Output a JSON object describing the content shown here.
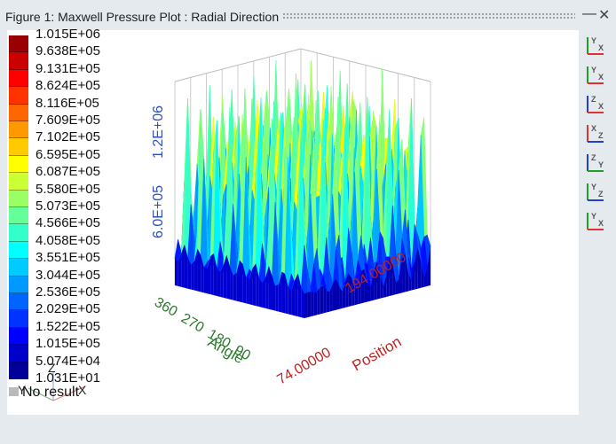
{
  "window": {
    "title": "Figure 1: Maxwell Pressure Plot : Radial Direction",
    "minimize": "—",
    "close": "✕"
  },
  "legend": {
    "labels": [
      "1.015E+06",
      "9.638E+05",
      "9.131E+05",
      "8.624E+05",
      "8.116E+05",
      "7.609E+05",
      "7.102E+05",
      "6.595E+05",
      "6.087E+05",
      "5.580E+05",
      "5.073E+05",
      "4.566E+05",
      "4.058E+05",
      "3.551E+05",
      "3.044E+05",
      "2.536E+05",
      "2.029E+05",
      "1.522E+05",
      "1.015E+05",
      "5.074E+04",
      "1.031E+01"
    ],
    "no_result": "No result"
  },
  "axes": {
    "z_ticks": [
      "1.2E+06",
      "6.0E+05"
    ],
    "angle_ticks": [
      "360",
      "270",
      "180",
      "90"
    ],
    "angle_label": "Angle",
    "position_ticks": [
      "194.00000",
      "74.00000"
    ],
    "position_label": "Position",
    "triad": {
      "x": "X",
      "y": "Y",
      "z": "Z"
    },
    "colors": {
      "z": "#3050c0",
      "angle": "#2a7a2a",
      "position": "#c02020"
    }
  },
  "toolbar": [
    {
      "icon": "view-xy-icon",
      "a": "Y",
      "b": "X"
    },
    {
      "icon": "view-x-negy-icon",
      "a": "Y",
      "b": "X"
    },
    {
      "icon": "view-xz-icon",
      "a": "Z",
      "b": "X"
    },
    {
      "icon": "view-negx-z-icon",
      "a": "X",
      "b": "Z"
    },
    {
      "icon": "view-yz-icon",
      "a": "Z",
      "b": "Y"
    },
    {
      "icon": "view-negy-z-icon",
      "a": "Y",
      "b": "Z"
    },
    {
      "icon": "view-iso-icon",
      "a": "Y",
      "b": "X"
    }
  ]
}
